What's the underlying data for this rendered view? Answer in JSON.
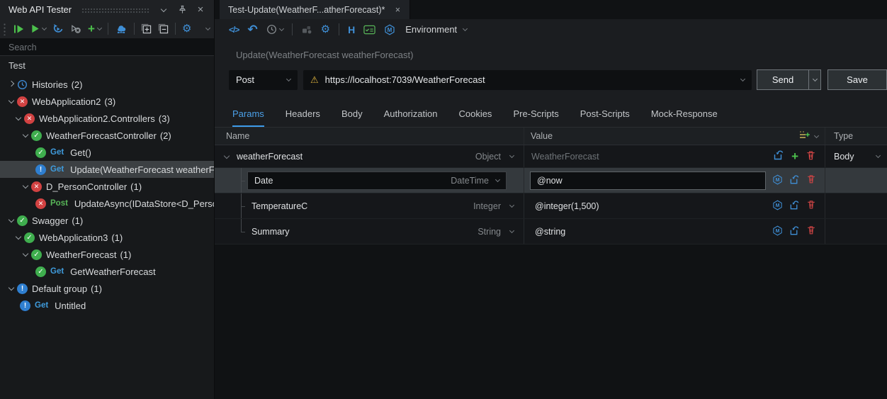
{
  "icons": {
    "close": "×",
    "plus": "+",
    "gear": "⚙",
    "undo": "↶",
    "warning": "⚠",
    "code": "</>",
    "headers": "H"
  },
  "colors": {
    "accent_blue": "#3f8fd6",
    "success_green": "#3fae4e",
    "error_red": "#d24242",
    "warn_blue": "#2f7fd0",
    "warning_yellow": "#dfb33d",
    "active_tab": "#4ba0e8"
  },
  "panel": {
    "title": "Web API Tester",
    "search_placeholder": "Search",
    "group_label": "Test",
    "tree": [
      {
        "label": "Histories",
        "count": "(2)",
        "status": "history"
      },
      {
        "label": "WebApplication2",
        "count": "(3)",
        "status": "error"
      },
      {
        "label": "WebApplication2.Controllers",
        "count": "(3)",
        "status": "error"
      },
      {
        "label": "WeatherForecastController",
        "count": "(2)",
        "status": "ok"
      },
      {
        "label": "Get()",
        "method": "Get",
        "status": "ok"
      },
      {
        "label": "Update(WeatherForecast weatherForecast)",
        "method": "Get",
        "status": "warn",
        "selected": true
      },
      {
        "label": "D_PersonController",
        "count": "(1)",
        "status": "error"
      },
      {
        "label": "UpdateAsync(IDataStore<D_Person> ",
        "method": "Post",
        "status": "error"
      },
      {
        "label": "Swagger",
        "count": "(1)",
        "status": "ok"
      },
      {
        "label": "WebApplication3",
        "count": "(1)",
        "status": "ok"
      },
      {
        "label": "WeatherForecast",
        "count": "(1)",
        "status": "ok"
      },
      {
        "label": "GetWeatherForecast",
        "method": "Get",
        "status": "ok"
      },
      {
        "label": "Default group",
        "count": "(1)",
        "status": "warn"
      },
      {
        "label": "Untitled",
        "method": "Get",
        "status": "warn"
      }
    ]
  },
  "document_tab": {
    "title": "Test-Update(WeatherF...atherForecast)*"
  },
  "toolbar": {
    "environment_label": "Environment"
  },
  "request": {
    "name": "Update(WeatherForecast weatherForecast)",
    "method": "Post",
    "url": "https://localhost:7039/WeatherForecast",
    "send_label": "Send",
    "save_label": "Save"
  },
  "tabs": {
    "active": "Params",
    "items": [
      "Params",
      "Headers",
      "Body",
      "Authorization",
      "Cookies",
      "Pre-Scripts",
      "Post-Scripts",
      "Mock-Response"
    ]
  },
  "params_table": {
    "headers": {
      "name": "Name",
      "value": "Value",
      "type": "Type"
    },
    "rows": [
      {
        "name": "weatherForecast",
        "datatype": "Object",
        "value_placeholder": "WeatherForecast",
        "body_type": "Body"
      },
      {
        "name": "Date",
        "datatype": "DateTime",
        "value": "@now"
      },
      {
        "name": "TemperatureC",
        "datatype": "Integer",
        "value": "@integer(1,500)"
      },
      {
        "name": "Summary",
        "datatype": "String",
        "value": "@string"
      }
    ]
  }
}
